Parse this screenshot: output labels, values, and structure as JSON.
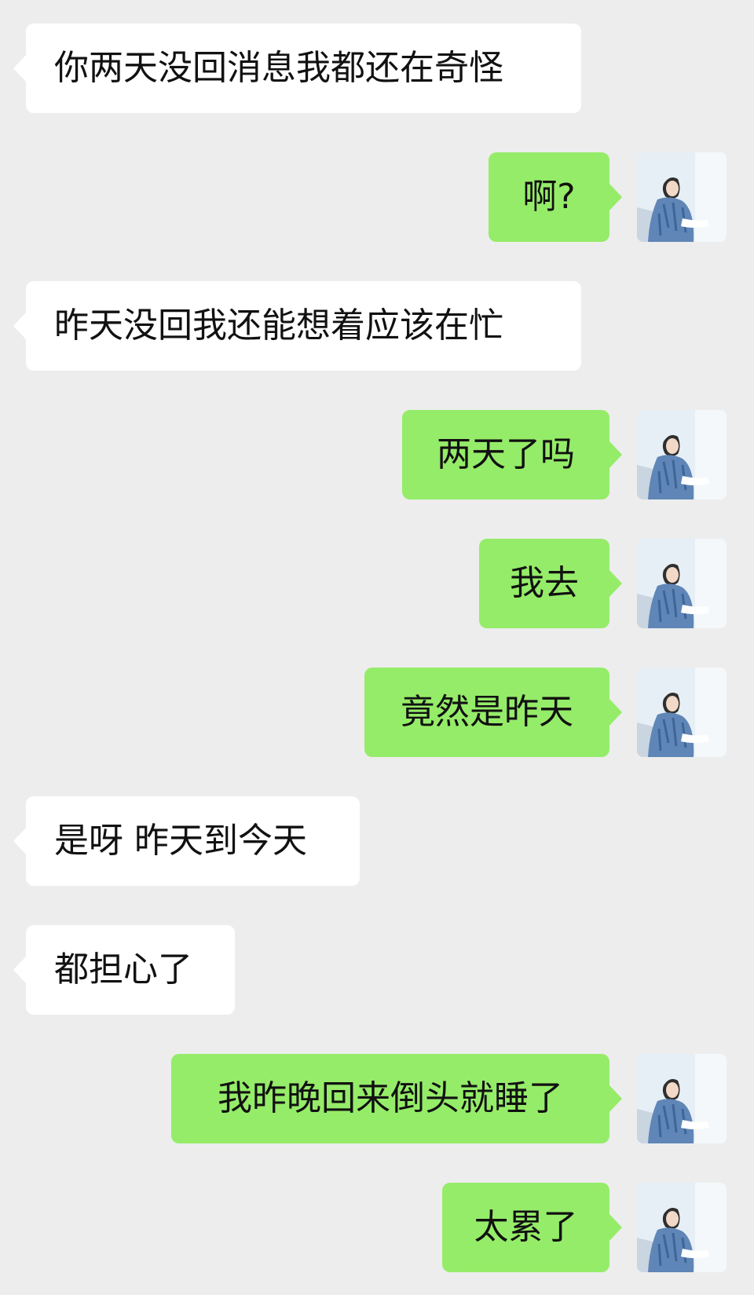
{
  "chat": {
    "messages": [
      {
        "side": "left",
        "text": "你两天没回消息我都还在奇怪"
      },
      {
        "side": "right",
        "text": "啊?"
      },
      {
        "side": "left",
        "text": "昨天没回我还能想着应该在忙"
      },
      {
        "side": "right",
        "text": "两天了吗"
      },
      {
        "side": "right",
        "text": "我去"
      },
      {
        "side": "right",
        "text": "竟然是昨天"
      },
      {
        "side": "left",
        "text": "是呀 昨天到今天"
      },
      {
        "side": "left",
        "text": "都担心了"
      },
      {
        "side": "right",
        "text": "我昨晚回来倒头就睡了"
      },
      {
        "side": "right",
        "text": "太累了"
      }
    ],
    "colors": {
      "background": "#ededed",
      "incoming_bubble": "#ffffff",
      "outgoing_bubble": "#95ec69",
      "text": "#111111"
    },
    "avatar_icon": "user-avatar-photo"
  }
}
